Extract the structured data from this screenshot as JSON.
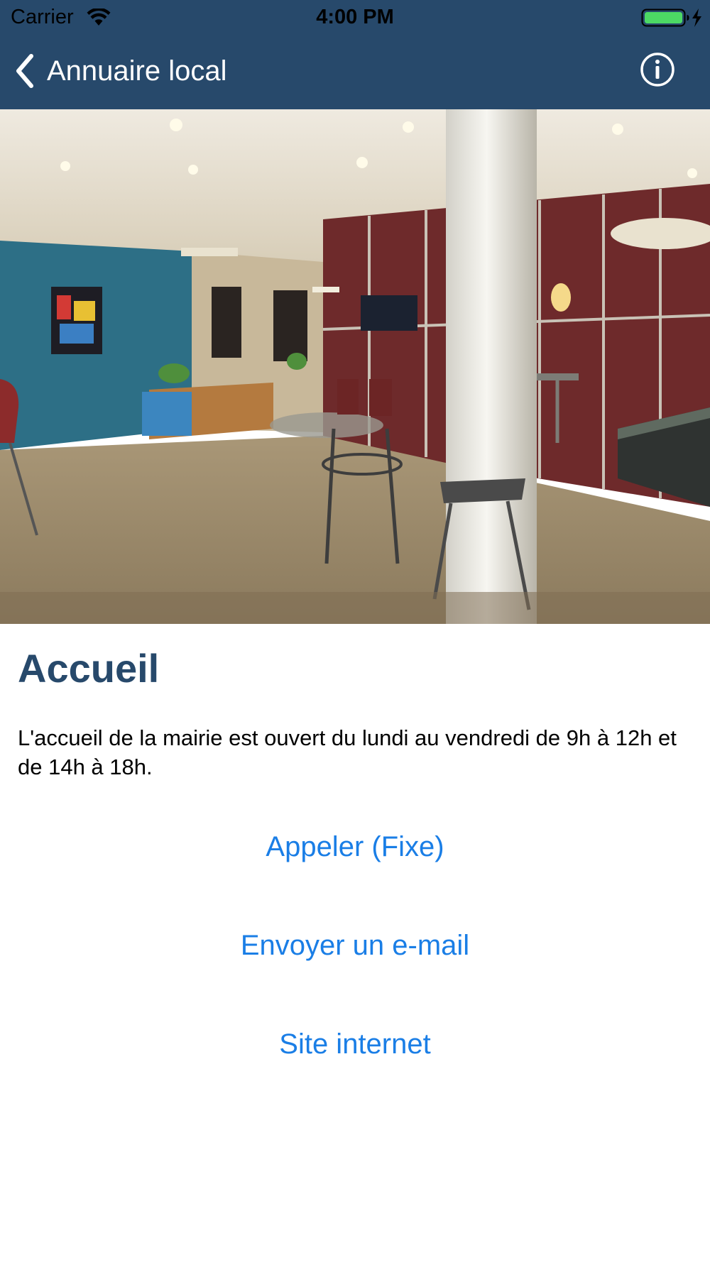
{
  "status_bar": {
    "carrier": "Carrier",
    "time": "4:00 PM",
    "icons": [
      "wifi-icon",
      "battery-charging-icon"
    ]
  },
  "nav": {
    "back_label": "Annuaire local",
    "back_icon": "chevron-left-icon",
    "info_icon": "info-circle-icon",
    "bar_color": "#27496b"
  },
  "hero": {
    "image": "lobby-interior-photo"
  },
  "content": {
    "title": "Accueil",
    "description": "L'accueil de la mairie est ouvert du lundi au vendredi de 9h à 12h et de 14h à 18h.",
    "title_color": "#27496b"
  },
  "actions": {
    "call_label": "Appeler (Fixe)",
    "email_label": "Envoyer un e-mail",
    "website_label": "Site internet",
    "link_color": "#1a7ee6"
  }
}
